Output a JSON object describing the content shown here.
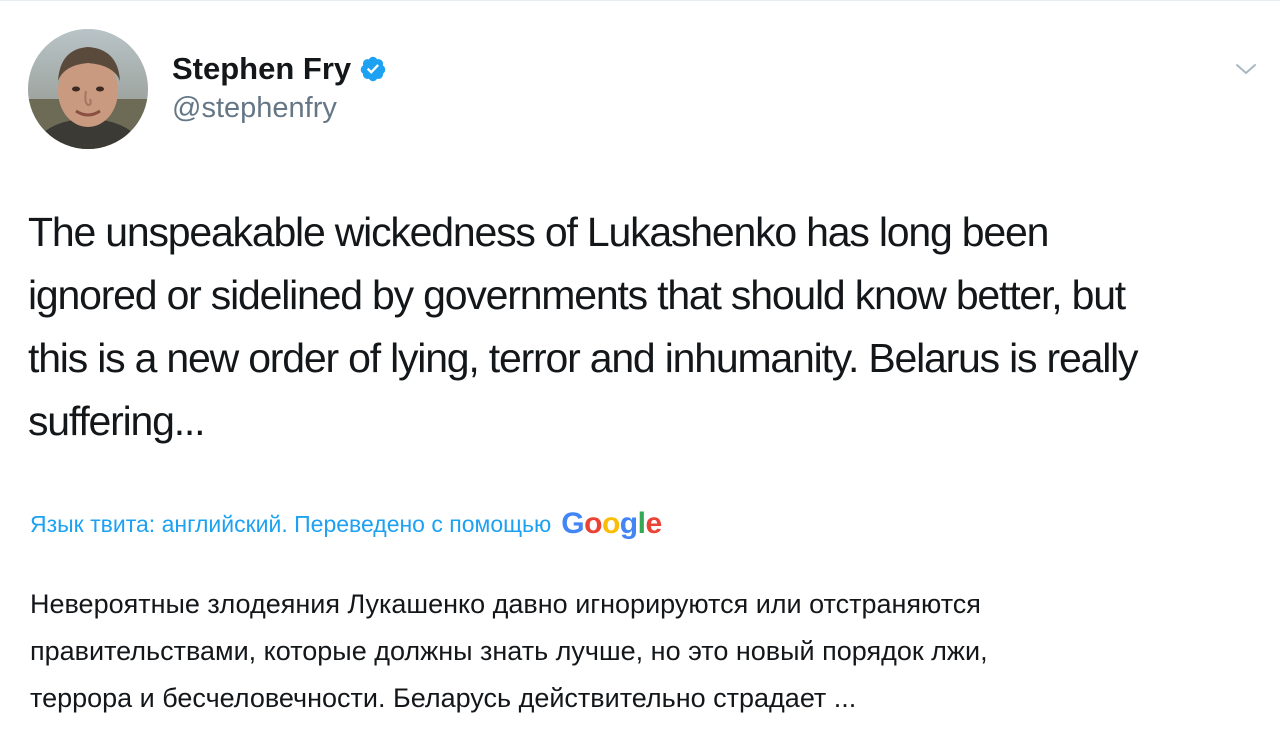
{
  "tweet": {
    "author": {
      "display_name": "Stephen Fry",
      "handle": "@stephenfry",
      "verified": true
    },
    "text_lines": [
      "The unspeakable wickedness of Lukashenko has long been",
      "ignored or sidelined by governments that should know better, but",
      "this is a new order of lying, terror and inhumanity. Belarus is really",
      "suffering..."
    ],
    "translation": {
      "label": "Язык твита: английский. Переведено с помощью",
      "provider_letters": [
        "G",
        "o",
        "o",
        "g",
        "l",
        "e"
      ],
      "text_lines": [
        "Невероятные злодеяния Лукашенко давно игнорируются или отстраняются",
        "правительствами, которые должны знать лучше, но это новый порядок лжи,",
        "террора и бесчеловечности. Беларусь действительно страдает ..."
      ]
    }
  },
  "icons": {
    "verified": "verified-badge-icon",
    "menu": "chevron-down-icon"
  },
  "colors": {
    "link_blue": "#1da1f2",
    "text_primary": "#14171a",
    "text_secondary": "#657786",
    "google_blue": "#4285f4",
    "google_red": "#ea4335",
    "google_yellow": "#fbbc05",
    "google_green": "#34a853"
  }
}
